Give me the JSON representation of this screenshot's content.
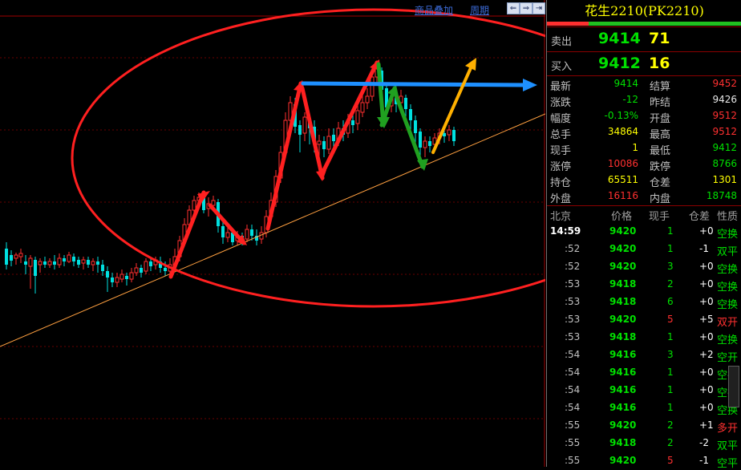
{
  "toolbar": {
    "overlay_label": "商品叠加",
    "period_label": "周期"
  },
  "header": {
    "title": "花生2210(PK2210)"
  },
  "orderbook": {
    "sell": {
      "label": "卖出",
      "price": "9414",
      "volume": "71"
    },
    "buy": {
      "label": "买入",
      "price": "9412",
      "volume": "16"
    }
  },
  "quote_rows": [
    {
      "l1": "最新",
      "v1": "9414",
      "c1": "#00e000",
      "l2": "结算",
      "v2": "9452",
      "c2": "#ff3030"
    },
    {
      "l1": "涨跌",
      "v1": "-12",
      "c1": "#00e000",
      "l2": "昨结",
      "v2": "9426",
      "c2": "#e8e8e8"
    },
    {
      "l1": "幅度",
      "v1": "-0.13%",
      "c1": "#00e000",
      "l2": "开盘",
      "v2": "9512",
      "c2": "#ff3030"
    },
    {
      "l1": "总手",
      "v1": "34864",
      "c1": "#ffff00",
      "l2": "最高",
      "v2": "9512",
      "c2": "#ff3030"
    },
    {
      "l1": "现手",
      "v1": "1",
      "c1": "#ffff00",
      "l2": "最低",
      "v2": "9412",
      "c2": "#00e000"
    },
    {
      "l1": "涨停",
      "v1": "10086",
      "c1": "#ff3030",
      "l2": "跌停",
      "v2": "8766",
      "c2": "#00e000"
    },
    {
      "l1": "持仓",
      "v1": "65511",
      "c1": "#ffff00",
      "l2": "仓差",
      "v2": "1301",
      "c2": "#ffff00"
    },
    {
      "l1": "外盘",
      "v1": "16116",
      "c1": "#ff3030",
      "l2": "内盘",
      "v2": "18748",
      "c2": "#00e000"
    }
  ],
  "ticks_header": {
    "time": "北京",
    "price": "价格",
    "vol": "现手",
    "oi": "仓差",
    "nature": "性质"
  },
  "ticks": [
    {
      "time": "14:59",
      "price": "9420",
      "vol": "1",
      "oi": "+0",
      "nature": "空换",
      "nc": "#00e000"
    },
    {
      "time": ":52",
      "price": "9420",
      "vol": "1",
      "oi": "-1",
      "nature": "双平",
      "nc": "#00e000"
    },
    {
      "time": ":52",
      "price": "9420",
      "vol": "3",
      "oi": "+0",
      "nature": "空换",
      "nc": "#00e000"
    },
    {
      "time": ":53",
      "price": "9418",
      "vol": "2",
      "oi": "+0",
      "nature": "空换",
      "nc": "#00e000"
    },
    {
      "time": ":53",
      "price": "9418",
      "vol": "6",
      "oi": "+0",
      "nature": "空换",
      "nc": "#00e000"
    },
    {
      "time": ":53",
      "price": "9420",
      "vol": "5",
      "oi": "+5",
      "nature": "双开",
      "nc": "#ff3030"
    },
    {
      "time": ":53",
      "price": "9418",
      "vol": "1",
      "oi": "+0",
      "nature": "空换",
      "nc": "#00e000"
    },
    {
      "time": ":54",
      "price": "9416",
      "vol": "3",
      "oi": "+2",
      "nature": "空开",
      "nc": "#00e000"
    },
    {
      "time": ":54",
      "price": "9416",
      "vol": "1",
      "oi": "+0",
      "nature": "空换",
      "nc": "#00e000"
    },
    {
      "time": ":54",
      "price": "9416",
      "vol": "1",
      "oi": "+0",
      "nature": "空换",
      "nc": "#00e000"
    },
    {
      "time": ":54",
      "price": "9416",
      "vol": "1",
      "oi": "+0",
      "nature": "空换",
      "nc": "#00e000"
    },
    {
      "time": ":55",
      "price": "9420",
      "vol": "2",
      "oi": "+1",
      "nature": "多开",
      "nc": "#ff3030"
    },
    {
      "time": ":55",
      "price": "9418",
      "vol": "2",
      "oi": "-2",
      "nature": "双平",
      "nc": "#00e000"
    },
    {
      "time": ":55",
      "price": "9420",
      "vol": "5",
      "oi": "-1",
      "nature": "空平",
      "nc": "#00e000"
    }
  ],
  "colors": {
    "up": "#ff3030",
    "down": "#00e0e0",
    "grid": "#8b0000",
    "trend": "#ffa040"
  }
}
